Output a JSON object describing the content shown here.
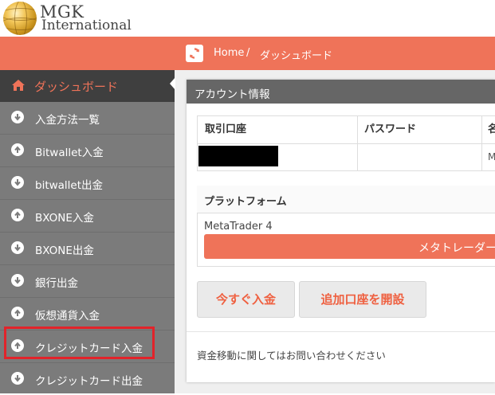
{
  "brand": {
    "name": "MGK",
    "subname": "International"
  },
  "breadcrumb": {
    "home": "Home",
    "separator": "/",
    "current": "ダッシュボード"
  },
  "sidebar": {
    "active": "ダッシュボード",
    "items": [
      {
        "label": "入金方法一覧"
      },
      {
        "label": "Bitwallet入金"
      },
      {
        "label": "bitwallet出金"
      },
      {
        "label": "BXONE入金"
      },
      {
        "label": "BXONE出金"
      },
      {
        "label": "銀行出金"
      },
      {
        "label": "仮想通貨入金"
      },
      {
        "label": "クレジットカード入金"
      },
      {
        "label": "クレジットカード出金"
      }
    ],
    "highlighted": "クレジットカード入金"
  },
  "account_panel": {
    "title": "アカウント情報",
    "columns": [
      "取引口座",
      "パスワード",
      "名"
    ],
    "row_truncated_text": "M"
  },
  "platform": {
    "header": "プラットフォーム",
    "name": "MetaTrader 4",
    "button_label": "メタトレーダー"
  },
  "actions": {
    "deposit_now": "今すぐ入金",
    "open_account": "追加口座を開設"
  },
  "footer_note": "資金移動に関してはお問い合わせください",
  "colors": {
    "accent": "#ef7359",
    "sidebar": "#7b7b7b",
    "sidebar_active": "#3f3f3f",
    "highlight_box": "#e2232a"
  }
}
